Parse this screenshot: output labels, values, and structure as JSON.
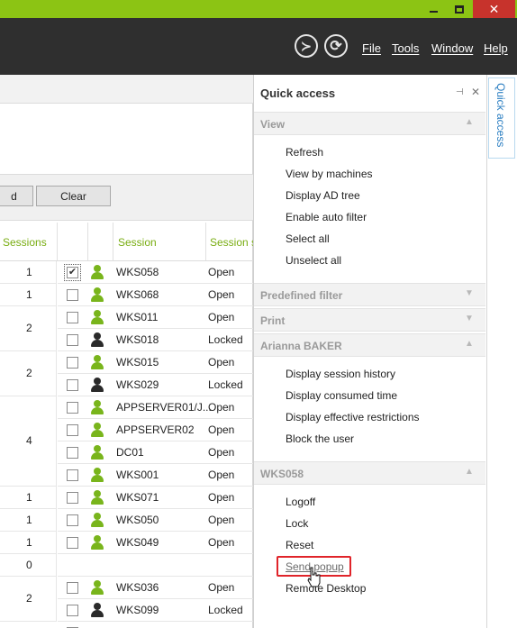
{
  "window": {
    "minimize": "",
    "maximize": "",
    "close": "✕"
  },
  "menu": {
    "run_icon": "≻",
    "sync_icon": "⟳",
    "file": "File",
    "tools": "Tools",
    "window": "Window",
    "help": "Help"
  },
  "toolbar": {
    "load_label": "d",
    "clear_label": "Clear"
  },
  "table": {
    "headers": {
      "sessions": "Sessions",
      "session": "Session",
      "session_state": "Session s"
    },
    "groups": [
      {
        "count": "1"
      },
      {
        "count": "1"
      },
      {
        "count": "2"
      },
      {
        "count": "2"
      },
      {
        "count": "4"
      },
      {
        "count": "1"
      },
      {
        "count": "1"
      },
      {
        "count": "1"
      },
      {
        "count": "0"
      },
      {
        "count": "2"
      }
    ],
    "rows": [
      {
        "name": "WKS058",
        "state": "Open",
        "checked": "✔",
        "icon": "user-green-icon"
      },
      {
        "name": "WKS068",
        "state": "Open",
        "checked": "",
        "icon": "user-green-icon"
      },
      {
        "name": "WKS011",
        "state": "Open",
        "checked": "",
        "icon": "user-green-icon"
      },
      {
        "name": "WKS018",
        "state": "Locked",
        "checked": "",
        "icon": "user-dark-icon"
      },
      {
        "name": "WKS015",
        "state": "Open",
        "checked": "",
        "icon": "user-green-icon"
      },
      {
        "name": "WKS029",
        "state": "Locked",
        "checked": "",
        "icon": "user-dark-icon"
      },
      {
        "name": "APPSERVER01/J...",
        "state": "Open",
        "checked": "",
        "icon": "user-green-icon"
      },
      {
        "name": "APPSERVER02",
        "state": "Open",
        "checked": "",
        "icon": "user-green-icon"
      },
      {
        "name": "DC01",
        "state": "Open",
        "checked": "",
        "icon": "user-green-icon"
      },
      {
        "name": "WKS001",
        "state": "Open",
        "checked": "",
        "icon": "user-green-icon"
      },
      {
        "name": "WKS071",
        "state": "Open",
        "checked": "",
        "icon": "user-green-icon"
      },
      {
        "name": "WKS050",
        "state": "Open",
        "checked": "",
        "icon": "user-green-icon"
      },
      {
        "name": "WKS049",
        "state": "Open",
        "checked": "",
        "icon": "user-green-icon"
      },
      {
        "name": "WKS036",
        "state": "Open",
        "checked": "",
        "icon": "user-green-icon"
      },
      {
        "name": "WKS099",
        "state": "Locked",
        "checked": "",
        "icon": "user-dark-icon"
      }
    ]
  },
  "quick_access": {
    "title": "Quick access",
    "pin_icon": "⊣",
    "close_icon": "✕",
    "tab_label": "Quick access",
    "sections": {
      "view": {
        "title": "View",
        "chevron": "▲",
        "items": [
          "Refresh",
          "View by machines",
          "Display AD tree",
          "Enable auto filter",
          "Select all",
          "Unselect all"
        ]
      },
      "predefined_filter": {
        "title": "Predefined filter",
        "chevron": "▼"
      },
      "print": {
        "title": "Print",
        "chevron": "▼"
      },
      "user": {
        "title": "Arianna BAKER",
        "chevron": "▲",
        "items": [
          "Display session history",
          "Display consumed time",
          "Display effective restrictions",
          "Block the user"
        ]
      },
      "machine": {
        "title": "WKS058",
        "chevron": "▲",
        "items": [
          "Logoff",
          "Lock",
          "Reset",
          "Send popup",
          "Remote Desktop"
        ]
      }
    }
  },
  "colors": {
    "accent_green": "#8cc414",
    "header_green": "#79ad12",
    "close_red": "#c7332c",
    "highlight_red": "#e0242a",
    "menubar_dark": "#2f2f2f"
  }
}
